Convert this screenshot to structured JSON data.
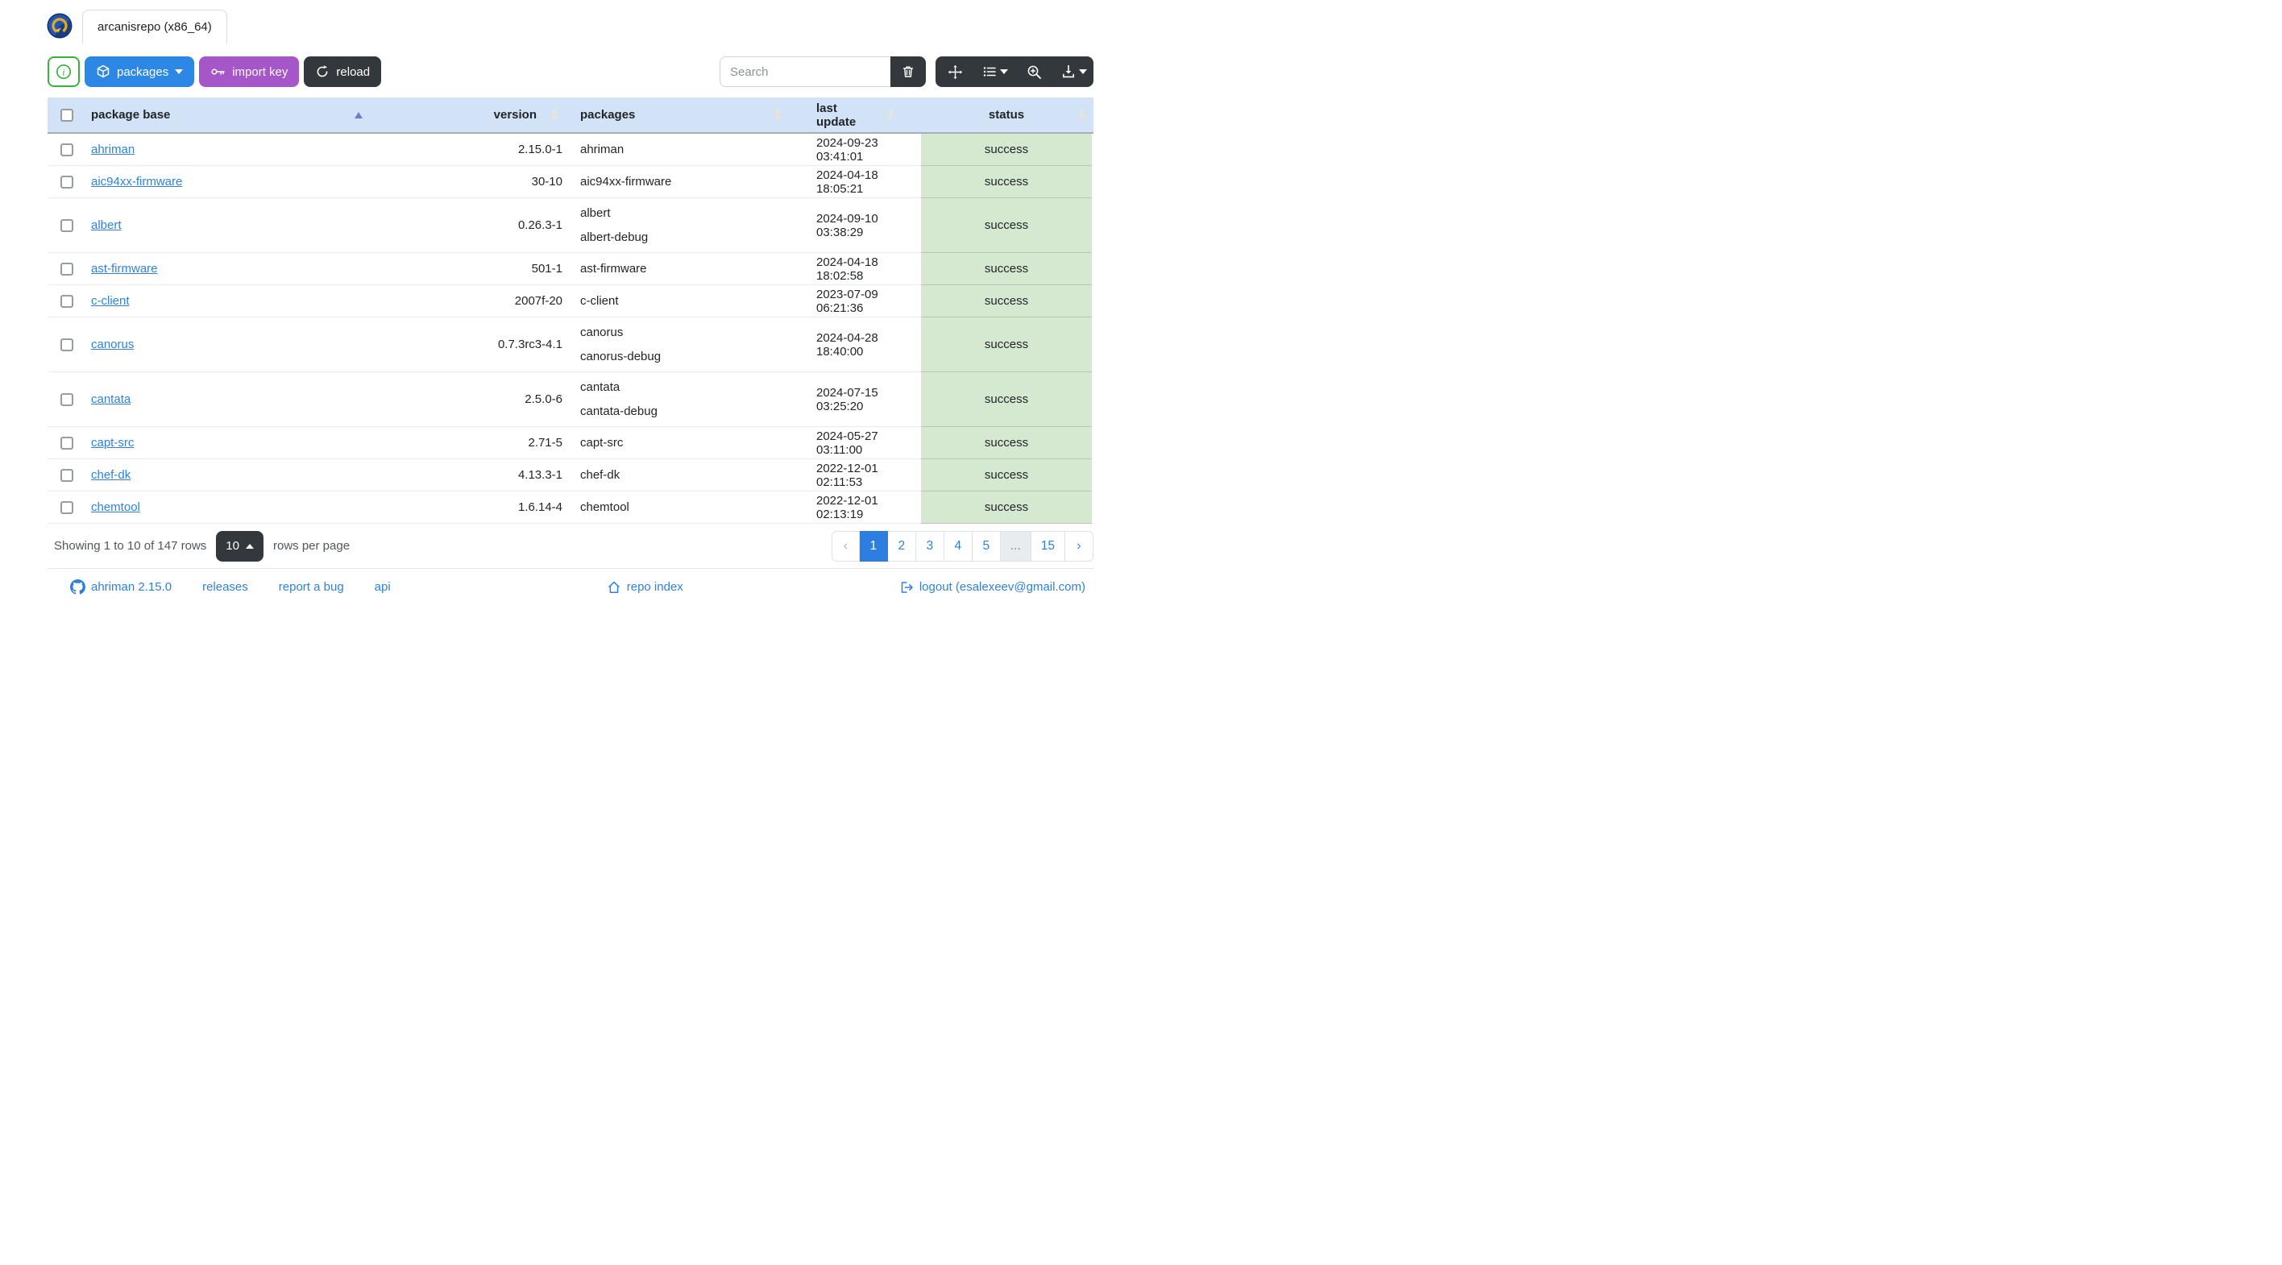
{
  "window": {
    "tab_title": "arcanisrepo (x86_64)"
  },
  "toolbar": {
    "packages_label": "packages",
    "import_key_label": "import key",
    "reload_label": "reload",
    "search_placeholder": "Search"
  },
  "colors": {
    "accent_blue": "#2d87e4",
    "accent_purple": "#a557c9",
    "accent_dark": "#33383d",
    "info_green": "#36b53b",
    "header_bg": "#d2e3f7",
    "status_success_bg": "#d5e8d0",
    "link_blue": "#2e82df"
  },
  "table": {
    "columns": [
      {
        "label": "",
        "name": "select"
      },
      {
        "label": "package base",
        "sort": "asc"
      },
      {
        "label": "version",
        "sort": "both"
      },
      {
        "label": "packages",
        "sort": "both"
      },
      {
        "label": "last update",
        "sort": "both"
      },
      {
        "label": "status",
        "sort": "both"
      }
    ],
    "rows": [
      {
        "base": "ahriman",
        "version": "2.15.0-1",
        "packages": [
          "ahriman"
        ],
        "last_update": "2024-09-23 03:41:01",
        "status": "success"
      },
      {
        "base": "aic94xx-firmware",
        "version": "30-10",
        "packages": [
          "aic94xx-firmware"
        ],
        "last_update": "2024-04-18 18:05:21",
        "status": "success"
      },
      {
        "base": "albert",
        "version": "0.26.3-1",
        "packages": [
          "albert",
          "albert-debug"
        ],
        "last_update": "2024-09-10 03:38:29",
        "status": "success"
      },
      {
        "base": "ast-firmware",
        "version": "501-1",
        "packages": [
          "ast-firmware"
        ],
        "last_update": "2024-04-18 18:02:58",
        "status": "success"
      },
      {
        "base": "c-client",
        "version": "2007f-20",
        "packages": [
          "c-client"
        ],
        "last_update": "2023-07-09 06:21:36",
        "status": "success"
      },
      {
        "base": "canorus",
        "version": "0.7.3rc3-4.1",
        "packages": [
          "canorus",
          "canorus-debug"
        ],
        "last_update": "2024-04-28 18:40:00",
        "status": "success"
      },
      {
        "base": "cantata",
        "version": "2.5.0-6",
        "packages": [
          "cantata",
          "cantata-debug"
        ],
        "last_update": "2024-07-15 03:25:20",
        "status": "success"
      },
      {
        "base": "capt-src",
        "version": "2.71-5",
        "packages": [
          "capt-src"
        ],
        "last_update": "2024-05-27 03:11:00",
        "status": "success"
      },
      {
        "base": "chef-dk",
        "version": "4.13.3-1",
        "packages": [
          "chef-dk"
        ],
        "last_update": "2022-12-01 02:11:53",
        "status": "success"
      },
      {
        "base": "chemtool",
        "version": "1.6.14-4",
        "packages": [
          "chemtool"
        ],
        "last_update": "2022-12-01 02:13:19",
        "status": "success"
      }
    ]
  },
  "pager": {
    "summary": "Showing 1 to 10 of 147 rows",
    "page_size": "10",
    "rows_per_page_label": "rows per page",
    "pagination": [
      {
        "label": "‹",
        "type": "prev"
      },
      {
        "label": "1",
        "type": "active"
      },
      {
        "label": "2",
        "type": "page"
      },
      {
        "label": "3",
        "type": "page"
      },
      {
        "label": "4",
        "type": "page"
      },
      {
        "label": "5",
        "type": "page"
      },
      {
        "label": "...",
        "type": "ellipsis"
      },
      {
        "label": "15",
        "type": "page"
      },
      {
        "label": "›",
        "type": "next"
      }
    ]
  },
  "footer": {
    "version_label": "ahriman 2.15.0",
    "releases_label": "releases",
    "report_bug_label": "report a bug",
    "api_label": "api",
    "repo_index_label": "repo index",
    "logout_label": "logout (esalexeev@gmail.com)"
  }
}
